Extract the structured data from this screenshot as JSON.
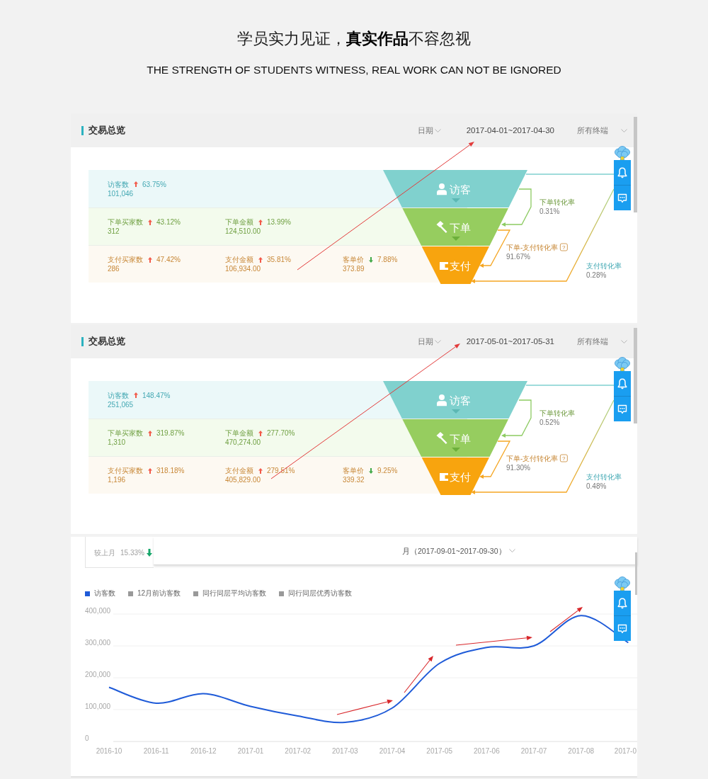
{
  "header": {
    "title": "学员实力见证，**真实作品**不容忽视",
    "subtitle": "THE STRENGTH OF STUDENTS WITNESS, REAL WORK CAN NOT BE IGNORED"
  },
  "overview_panels": [
    {
      "title": "交易总览",
      "date_filter": "日期",
      "date_range": "2017-04-01~2017-04-30",
      "terminal_filter": "所有终端",
      "rows": [
        {
          "kind": "visitor",
          "metrics": [
            {
              "label": "访客数",
              "rising": true,
              "change": "63.75%",
              "value": "101,046"
            }
          ]
        },
        {
          "kind": "order",
          "metrics": [
            {
              "label": "下单买家数",
              "rising": true,
              "change": "43.12%",
              "value": "312"
            },
            {
              "label": "下单金额",
              "rising": true,
              "change": "13.99%",
              "value": "124,510.00"
            }
          ]
        },
        {
          "kind": "payment",
          "metrics": [
            {
              "label": "支付买家数",
              "rising": true,
              "change": "47.42%",
              "value": "286"
            },
            {
              "label": "支付金额",
              "rising": true,
              "change": "35.81%",
              "value": "106,934.00"
            },
            {
              "label": "客单价",
              "rising": false,
              "change": "7.88%",
              "value": "373.89"
            }
          ]
        }
      ],
      "funnel": [
        {
          "kind": "visitor",
          "label": "访客"
        },
        {
          "kind": "order",
          "label": "下单"
        },
        {
          "kind": "payment",
          "label": "支付"
        }
      ],
      "conversions": [
        {
          "kind": "order",
          "label": "下单转化率",
          "value": "0.31%"
        },
        {
          "kind": "order_payment",
          "label": "下单-支付转化率",
          "help": "?",
          "value": "91.67%"
        },
        {
          "kind": "payment",
          "label": "支付转化率",
          "value": "0.28%"
        }
      ]
    },
    {
      "title": "交易总览",
      "date_filter": "日期",
      "date_range": "2017-05-01~2017-05-31",
      "terminal_filter": "所有终端",
      "rows": [
        {
          "kind": "visitor",
          "metrics": [
            {
              "label": "访客数",
              "rising": true,
              "change": "148.47%",
              "value": "251,065"
            }
          ]
        },
        {
          "kind": "order",
          "metrics": [
            {
              "label": "下单买家数",
              "rising": true,
              "change": "319.87%",
              "value": "1,310"
            },
            {
              "label": "下单金额",
              "rising": true,
              "change": "277.70%",
              "value": "470,274.00"
            }
          ]
        },
        {
          "kind": "payment",
          "metrics": [
            {
              "label": "支付买家数",
              "rising": true,
              "change": "318.18%",
              "value": "1,196"
            },
            {
              "label": "支付金额",
              "rising": true,
              "change": "279.51%",
              "value": "405,829.00"
            },
            {
              "label": "客单价",
              "rising": false,
              "change": "9.25%",
              "value": "339.32"
            }
          ]
        }
      ],
      "funnel": [
        {
          "kind": "visitor",
          "label": "访客"
        },
        {
          "kind": "order",
          "label": "下单"
        },
        {
          "kind": "payment",
          "label": "支付"
        }
      ],
      "conversions": [
        {
          "kind": "order",
          "label": "下单转化率",
          "value": "0.52%"
        },
        {
          "kind": "order_payment",
          "label": "下单-支付转化率",
          "help": "?",
          "value": "91.30%"
        },
        {
          "kind": "payment",
          "label": "支付转化率",
          "value": "0.48%"
        }
      ]
    }
  ],
  "visitor_trend_panel": {
    "comparison": {
      "label": "较上月",
      "change": "15.33%",
      "rising": false
    },
    "period": "月（2017-09-01~2017-09-30）",
    "chart_data": {
      "type": "line",
      "grid": true,
      "categories": [
        "2016-10",
        "2016-11",
        "2016-12",
        "2017-01",
        "2017-02",
        "2017-03",
        "2017-04",
        "2017-05",
        "2017-06",
        "2017-07",
        "2017-08",
        "2017-0"
      ],
      "series": [
        {
          "name": "访客数",
          "color": "#1f5bd8",
          "values": [
            170000,
            120000,
            150000,
            110000,
            80000,
            60000,
            105000,
            245000,
            295000,
            300000,
            395000,
            310000
          ]
        },
        {
          "name": "12月前访客数",
          "color": "#999999",
          "values": [
            null,
            null,
            null,
            null,
            null,
            null,
            null,
            null,
            null,
            null,
            null,
            null
          ]
        },
        {
          "name": "同行同层平均访客数",
          "color": "#999999",
          "values": [
            null,
            null,
            null,
            null,
            null,
            null,
            null,
            null,
            null,
            null,
            null,
            null
          ]
        },
        {
          "name": "同行同层优秀访客数",
          "color": "#999999",
          "values": [
            null,
            null,
            null,
            null,
            null,
            null,
            null,
            null,
            null,
            null,
            null,
            null
          ]
        }
      ],
      "ylim": [
        0,
        400000
      ],
      "yticks": [
        {
          "value": 0,
          "label": "0"
        },
        {
          "value": 100000,
          "label": "100,000"
        },
        {
          "value": 200000,
          "label": "200,000"
        },
        {
          "value": 300000,
          "label": "300,000"
        },
        {
          "value": 400000,
          "label": "400,000"
        }
      ]
    }
  }
}
